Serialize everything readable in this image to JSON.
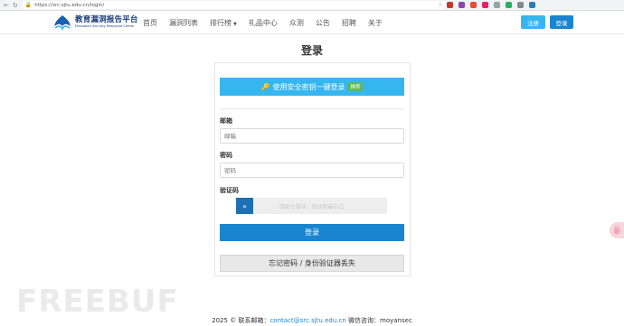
{
  "browser": {
    "url": "https://src.sjtu.edu.cn/login/"
  },
  "header": {
    "logo_cn": "教育漏洞报告平台",
    "logo_en": "Education Security Response Center",
    "nav": [
      {
        "label": "首页"
      },
      {
        "label": "漏洞列表"
      },
      {
        "label": "排行榜",
        "dropdown": true
      },
      {
        "label": "礼品中心"
      },
      {
        "label": "众测"
      },
      {
        "label": "公告"
      },
      {
        "label": "招聘"
      },
      {
        "label": "关于"
      }
    ],
    "register_label": "注册",
    "login_label": "登录"
  },
  "login": {
    "title": "登录",
    "security_key_label": "使用安全密钥一键登录",
    "security_key_badge": "推荐",
    "email_label": "邮箱",
    "email_placeholder": "邮箱",
    "password_label": "密码",
    "password_placeholder": "密码",
    "captcha_label": "验证码",
    "slider_text": "请按住滑块，拖动到最右边",
    "slider_icon": "double-chevron-right-icon",
    "submit_label": "登录",
    "forgot_label": "忘记密码 / 身份验证器丢失"
  },
  "footer": {
    "prefix": "2025 © 联系邮箱：",
    "email": "contact@src.sjtu.edu.cn",
    "wechat": " 微信咨询：moyansec"
  },
  "watermark": "FREEBUF",
  "colors": {
    "primary": "#1985d0",
    "light_blue": "#36b6ef",
    "slider_handle": "#1f6fb3",
    "badge_green": "#5cb85c"
  }
}
